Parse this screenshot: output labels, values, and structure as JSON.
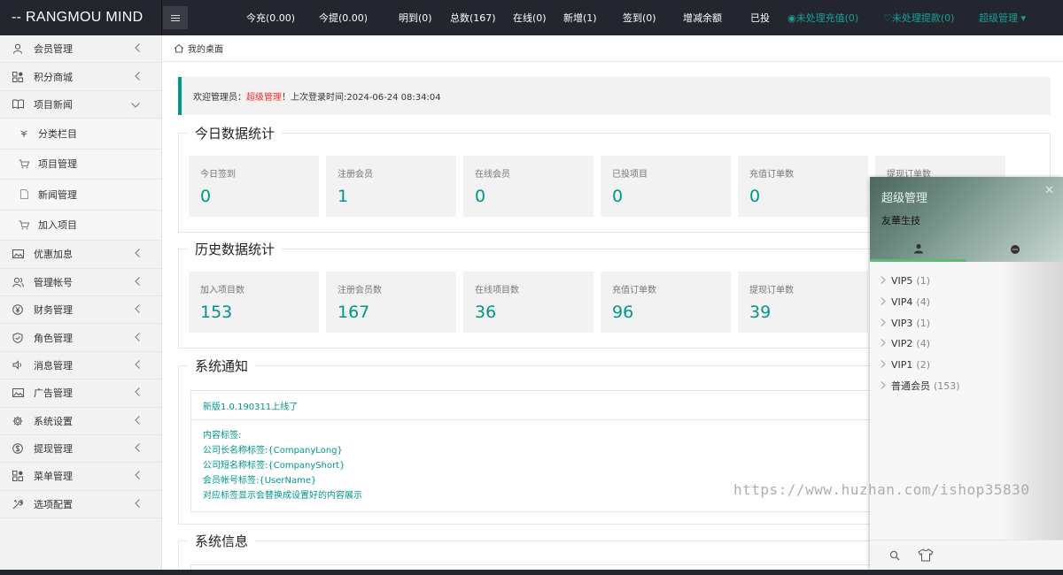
{
  "brand": "-- RANGMOU MIND",
  "topnav": [
    {
      "label": "今充(0.00)",
      "color": "#ffffff"
    },
    {
      "label": "今提(0.00)",
      "color": "#ffffff"
    },
    {
      "label": "明到(0)",
      "color": "#ffffff"
    },
    {
      "label": "总数(167)",
      "color": "#ffffff"
    },
    {
      "label": "在线(0)",
      "color": "#ffffff"
    },
    {
      "label": "新增(1)",
      "color": "#ffffff"
    },
    {
      "label": "签到(0)",
      "color": "#ffffff"
    },
    {
      "label": "增减余额",
      "color": "#ffffff"
    },
    {
      "label": "已投",
      "color": "#ffffff"
    },
    {
      "label": "◉未处理充值(0)",
      "color": "#1aa094"
    },
    {
      "label": "♡未处理提款(0)",
      "color": "#1aa094"
    },
    {
      "label": "超级管理 ▾",
      "color": "#1aa094"
    }
  ],
  "sidebar": {
    "items": [
      {
        "label": "会员管理",
        "icon": "user-icon"
      },
      {
        "label": "积分商城",
        "icon": "apps-icon"
      },
      {
        "label": "项目新闻",
        "icon": "book-icon",
        "expanded": true
      },
      {
        "label": "分类栏目",
        "icon": "leaf-icon",
        "sub": true
      },
      {
        "label": "项目管理",
        "icon": "cart-icon",
        "sub": true
      },
      {
        "label": "新闻管理",
        "icon": "file-icon",
        "sub": true
      },
      {
        "label": "加入项目",
        "icon": "cart-icon",
        "sub": true
      },
      {
        "label": "优惠加息",
        "icon": "image-icon"
      },
      {
        "label": "管理帐号",
        "icon": "users-icon"
      },
      {
        "label": "财务管理",
        "icon": "yen-icon"
      },
      {
        "label": "角色管理",
        "icon": "shield-icon"
      },
      {
        "label": "消息管理",
        "icon": "speaker-icon"
      },
      {
        "label": "广告管理",
        "icon": "image-icon"
      },
      {
        "label": "系统设置",
        "icon": "gear-icon"
      },
      {
        "label": "提现管理",
        "icon": "dollar-icon"
      },
      {
        "label": "菜单管理",
        "icon": "apps-icon"
      },
      {
        "label": "选项配置",
        "icon": "tools-icon"
      }
    ]
  },
  "tab": {
    "label": "我的桌面",
    "icon": "home-icon"
  },
  "welcome": {
    "prefix": "欢迎管理员：",
    "role": "超级管理",
    "suffix": "！上次登录时间:2024-06-24 08:34:04"
  },
  "today": {
    "title": "今日数据统计",
    "cards": [
      {
        "label": "今日签到",
        "value": "0"
      },
      {
        "label": "注册会员",
        "value": "1"
      },
      {
        "label": "在线会员",
        "value": "0"
      },
      {
        "label": "已投项目",
        "value": "0"
      },
      {
        "label": "充值订单数",
        "value": "0"
      },
      {
        "label": "提现订单数",
        "value": ""
      }
    ]
  },
  "history": {
    "title": "历史数据统计",
    "cards": [
      {
        "label": "加入项目数",
        "value": "153"
      },
      {
        "label": "注册会员数",
        "value": "167"
      },
      {
        "label": "在线项目数",
        "value": "36"
      },
      {
        "label": "充值订单数",
        "value": "96"
      },
      {
        "label": "提现订单数",
        "value": "39"
      }
    ]
  },
  "notice": {
    "title": "系统通知",
    "headline": "新版1.0.190311上线了",
    "lines": [
      "内容标签:",
      "公司长名称标签:{CompanyLong}",
      "公司短名称标签:{CompanyShort}",
      "会员帐号标签:{UserName}",
      "对应标签显示会替换成设置好的内容展示"
    ]
  },
  "sysinfo": {
    "title": "系统信息"
  },
  "chat": {
    "username": "超级管理",
    "sign": "友華生技",
    "close": "✕",
    "groups": [
      {
        "name": "VIP5",
        "count": "(1)"
      },
      {
        "name": "VIP4",
        "count": "(4)"
      },
      {
        "name": "VIP3",
        "count": "(1)"
      },
      {
        "name": "VIP2",
        "count": "(4)"
      },
      {
        "name": "VIP1",
        "count": "(2)"
      },
      {
        "name": "普通会员",
        "count": "(153)"
      }
    ]
  },
  "watermark": "https://www.huzhan.com/ishop35830",
  "colors": {
    "accent": "#009688",
    "topbar": "#23262e",
    "active_tab": "#5fb878",
    "warning": "#ff2d2d"
  }
}
